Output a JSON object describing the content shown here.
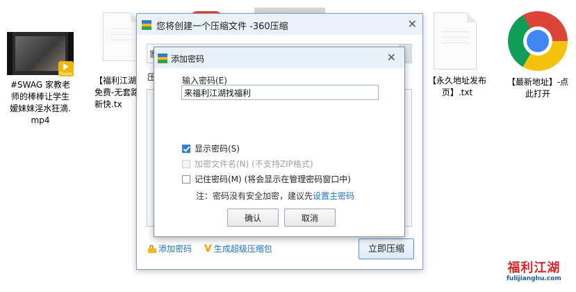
{
  "desktop": {
    "icons": [
      {
        "label": "#SWAG 家教老\n师的棒棒让学生\n嫒妹妹淫水狂滴.\nmp4",
        "badge": "Player"
      },
      {
        "label": "【福利江湖\n免费-无套路\n新快.tx"
      },
      {
        "label": "【永久地址发布\n页】.txt"
      },
      {
        "label": "【最新地址】-点\n此打开"
      }
    ]
  },
  "main_window": {
    "title": "您将创建一个压缩文件 -360压缩",
    "filename_partial": "家",
    "left_label_partial": "压",
    "add_password_link": "添加密码",
    "super_package_link": "生成超级压缩包",
    "compress_button": "立即压缩"
  },
  "password_dialog": {
    "title": "添加密码",
    "input_label": "输入密码(E)",
    "password_value": "来福利江湖找福利",
    "show_password": {
      "label": "显示密码(S)",
      "checked": true
    },
    "encrypt_filenames": {
      "label": "加密文件名(N)",
      "hint": "(不支持ZIP格式)",
      "checked": false,
      "disabled": true
    },
    "remember_password": {
      "label": "记住密码(M)",
      "hint": "(将会显示在管理密码窗口中)",
      "checked": false
    },
    "note_prefix": "注：密码没有安全加密，建议先",
    "note_link": "设置主密码",
    "ok_button": "确认",
    "cancel_button": "取消"
  },
  "watermark": {
    "cn": "福利江湖",
    "en": "fulijianghu.com"
  },
  "colors": {
    "accent": "#1b73c9",
    "checkbox_checked": "#2f7fd6",
    "title_bar": "#e8f0f8",
    "watermark_red": "#d3262b"
  }
}
